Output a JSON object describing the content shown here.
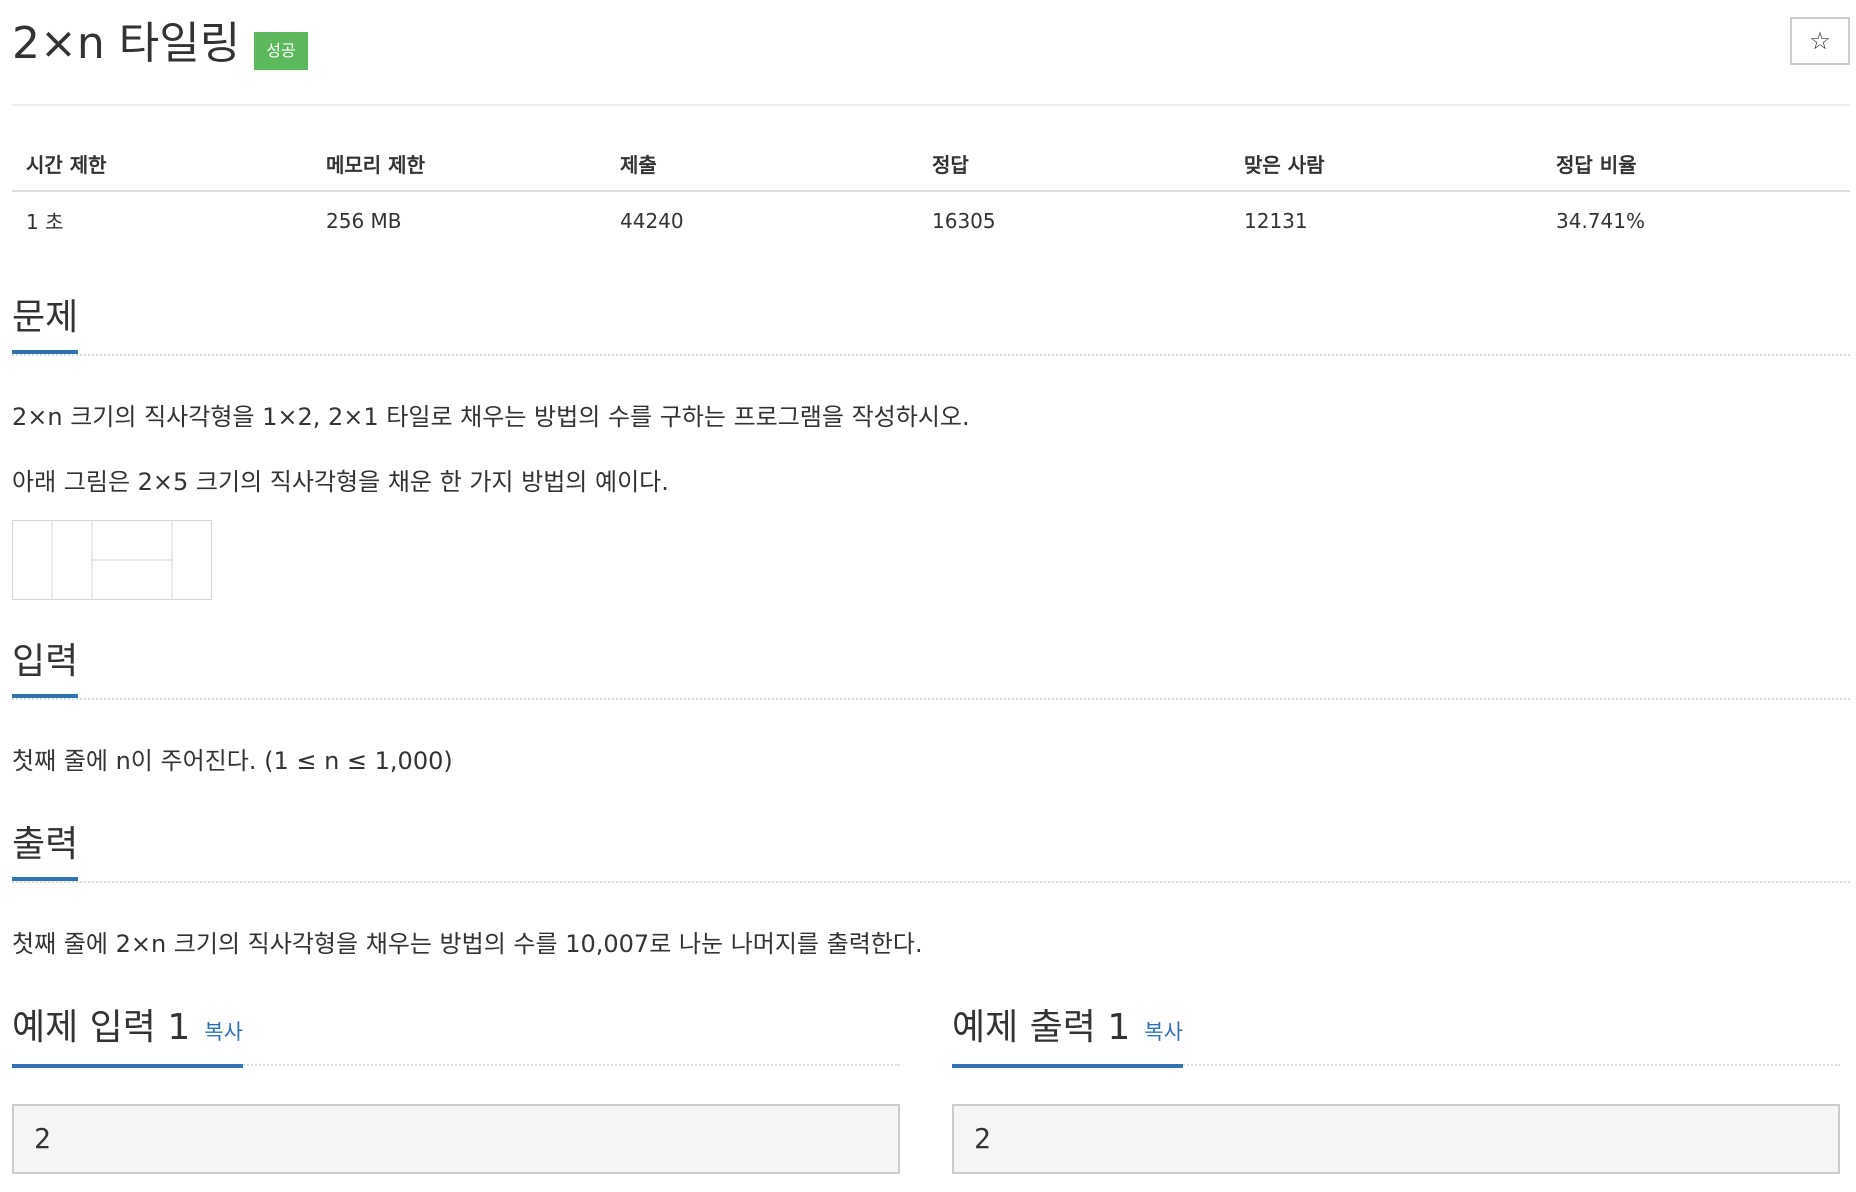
{
  "problem": {
    "title": "2×n 타일링",
    "badge": "성공",
    "star_icon": "☆"
  },
  "info": {
    "headers": [
      "시간 제한",
      "메모리 제한",
      "제출",
      "정답",
      "맞은 사람",
      "정답 비율"
    ],
    "values": [
      "1 초",
      "256 MB",
      "44240",
      "16305",
      "12131",
      "34.741%"
    ]
  },
  "sections": {
    "problem": {
      "heading": "문제",
      "paragraphs": [
        "2×n 크기의 직사각형을 1×2, 2×1 타일로 채우는 방법의 수를 구하는 프로그램을 작성하시오.",
        "아래 그림은 2×5 크기의 직사각형을 채운 한 가지 방법의 예이다."
      ]
    },
    "input": {
      "heading": "입력",
      "text": "첫째 줄에 n이 주어진다. (1 ≤ n ≤ 1,000)"
    },
    "output": {
      "heading": "출력",
      "text": "첫째 줄에 2×n 크기의 직사각형을 채우는 방법의 수를 10,007로 나눈 나머지를 출력한다."
    }
  },
  "samples": {
    "input": {
      "heading": "예제 입력 1",
      "copy": "복사",
      "value": "2"
    },
    "output": {
      "heading": "예제 출력 1",
      "copy": "복사",
      "value": "2"
    }
  },
  "colors": {
    "accent": "#2f73b7",
    "success": "#5cb85c"
  }
}
